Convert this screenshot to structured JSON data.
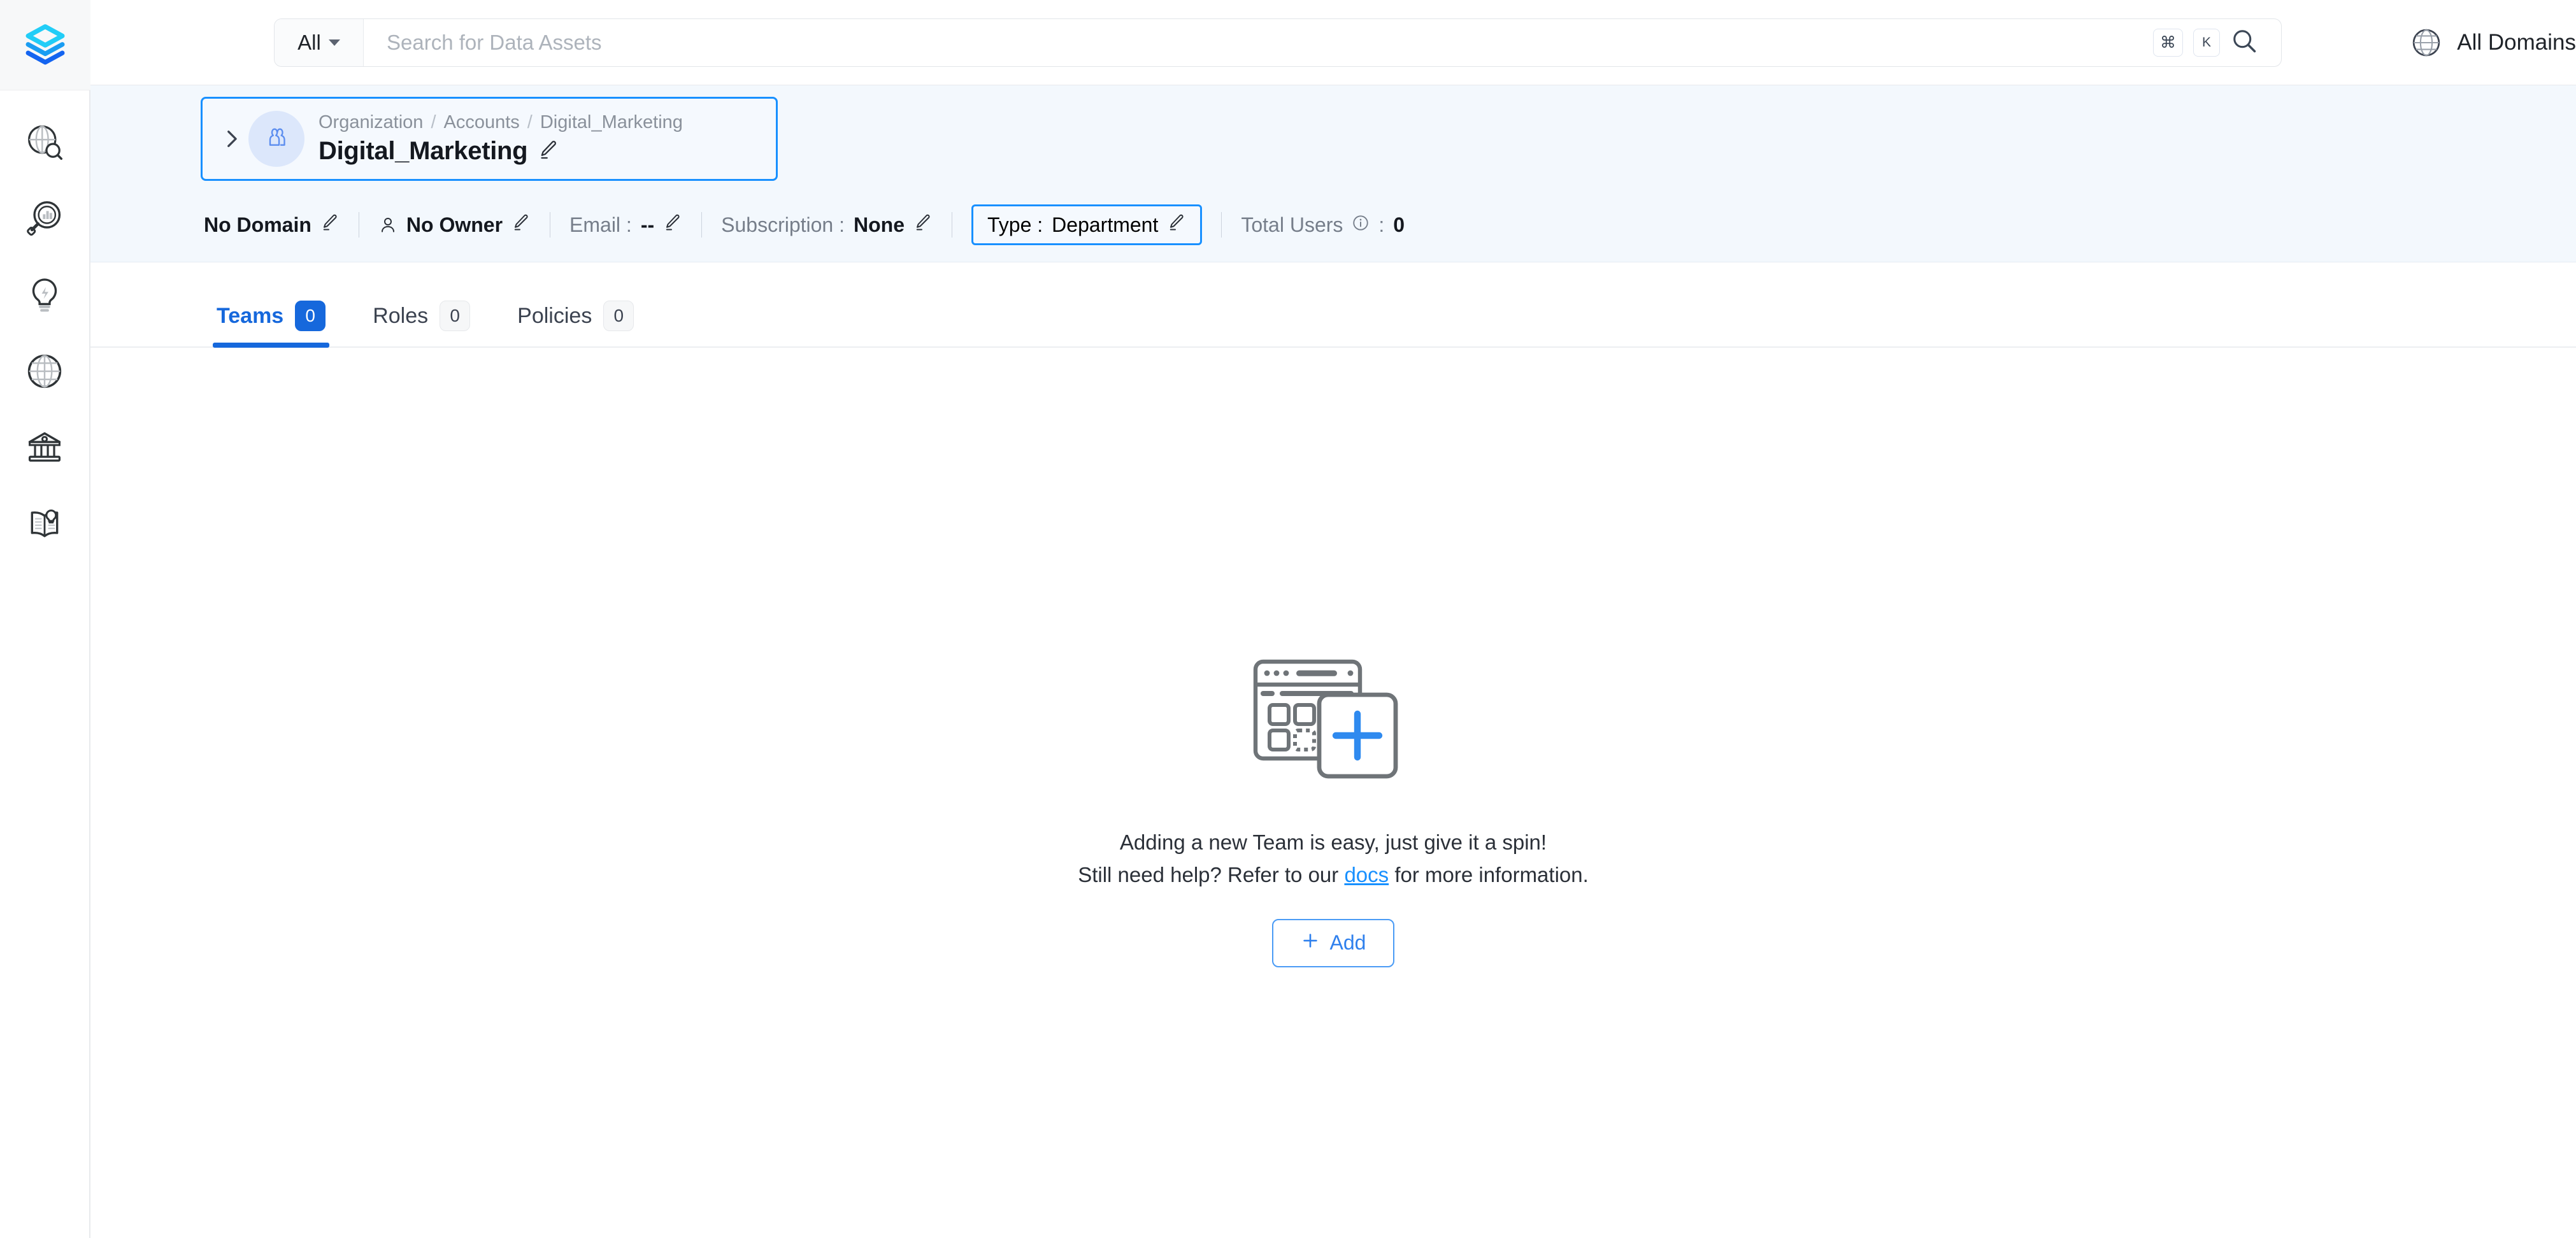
{
  "app": {
    "logo_name": "openmetadata-layers-logo"
  },
  "sidebar": {
    "items": [
      {
        "name": "explore",
        "icon": "globe-search-icon"
      },
      {
        "name": "observability",
        "icon": "magnifier-chart-icon"
      },
      {
        "name": "insights",
        "icon": "lightbulb-bolt-icon"
      },
      {
        "name": "domains",
        "icon": "globe-icon"
      },
      {
        "name": "governance",
        "icon": "bank-icon"
      },
      {
        "name": "glossary",
        "icon": "book-lightbulb-icon"
      }
    ]
  },
  "search": {
    "scope_label": "All",
    "placeholder": "Search for Data Assets",
    "value": "",
    "shortcut_keys": [
      "⌘",
      "K"
    ],
    "search_icon": "search-icon"
  },
  "domain_selector": {
    "label": "All Domains",
    "icon": "globe-icon"
  },
  "entity": {
    "breadcrumb": [
      "Organization",
      "Accounts",
      "Digital_Marketing"
    ],
    "breadcrumb_separator": "/",
    "title": "Digital_Marketing",
    "avatar_icon": "team-people-icon",
    "expand_icon": "chevron-right-icon",
    "edit_icon": "pencil-icon"
  },
  "meta": {
    "domain": {
      "label": "No Domain"
    },
    "owner": {
      "label": "No Owner",
      "icon": "user-icon"
    },
    "email": {
      "label": "Email :",
      "value": "--"
    },
    "subscription": {
      "label": "Subscription :",
      "value": "None"
    },
    "type": {
      "label": "Type :",
      "value": "Department",
      "highlighted": true
    },
    "total_users": {
      "label": "Total Users",
      "info_icon": "info-circle-icon",
      "separator": ":",
      "value": "0"
    }
  },
  "tabs": [
    {
      "label": "Teams",
      "count": "0",
      "active": true
    },
    {
      "label": "Roles",
      "count": "0",
      "active": false
    },
    {
      "label": "Policies",
      "count": "0",
      "active": false
    }
  ],
  "empty_state": {
    "illustration": "add-placeholder-illustration",
    "line1": "Adding a new Team is easy, just give it a spin!",
    "line2_before": "Still need help? Refer to our ",
    "line2_link": "docs",
    "line2_after": " for more information.",
    "add_button": "Add",
    "add_icon": "plus-icon"
  },
  "colors": {
    "accent_blue": "#1668dc",
    "link_blue": "#1890ff",
    "panel_bg": "#f3f8fd",
    "logo_cyan": "#22cdf7",
    "logo_blue": "#1464f0"
  }
}
